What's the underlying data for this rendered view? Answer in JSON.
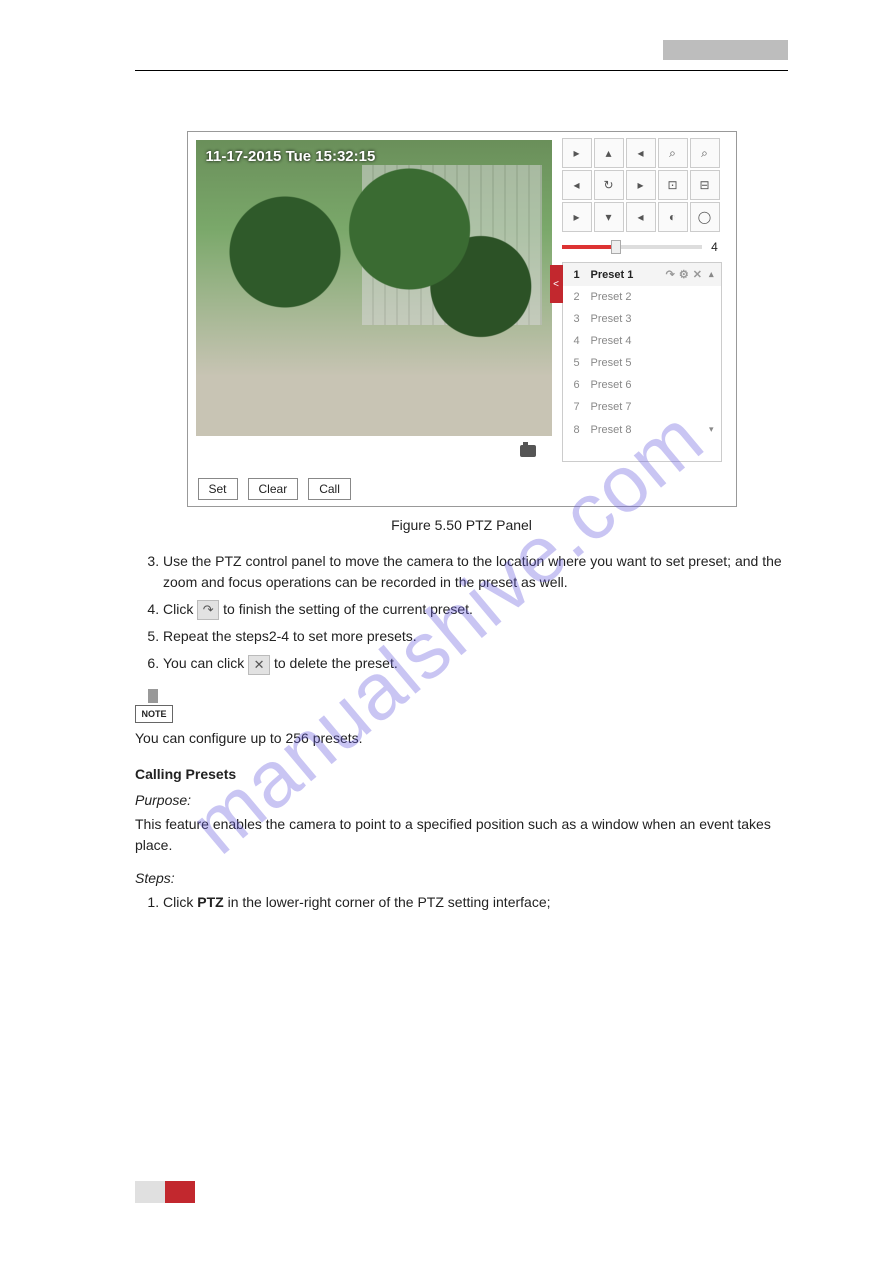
{
  "watermark": "manualshive.com",
  "figure": {
    "osd_text": "11-17-2015 Tue 15:32:15",
    "slider_value": "4",
    "presets": [
      {
        "num": "1",
        "label": "Preset 1"
      },
      {
        "num": "2",
        "label": "Preset 2"
      },
      {
        "num": "3",
        "label": "Preset 3"
      },
      {
        "num": "4",
        "label": "Preset 4"
      },
      {
        "num": "5",
        "label": "Preset 5"
      },
      {
        "num": "6",
        "label": "Preset 6"
      },
      {
        "num": "7",
        "label": "Preset 7"
      },
      {
        "num": "8",
        "label": "Preset 8"
      }
    ],
    "buttons": {
      "set": "Set",
      "clear": "Clear",
      "call": "Call"
    },
    "preset_action_call": "↷",
    "preset_action_gear": "⚙",
    "preset_action_del": "✕",
    "collapse_glyph": "<",
    "caption": "Figure 5.50 PTZ Panel"
  },
  "ptz_glyphs": {
    "ul": "▸",
    "u": "▴",
    "ur": "◂",
    "zp": "⌕",
    "zm": "⌕",
    "l": "◂",
    "c": "↻",
    "r": "▸",
    "fp": "⊡",
    "fm": "⊟",
    "dl": "▸",
    "d": "▾",
    "dr": "◂",
    "ip": "◐",
    "im": "◯"
  },
  "steps_1": {
    "s3": "Use the PTZ control panel to move the camera to the location where you want to set preset; and the zoom and focus operations can be recorded in the preset as well.",
    "s4a": "Click ",
    "s4b": " to finish the setting of the current preset.",
    "s5": "Repeat the steps2-4 to set more presets.",
    "s6a": "You can click ",
    "s6b": " to delete the preset."
  },
  "note": {
    "label": "NOTE",
    "text": "You can configure up to 256 presets."
  },
  "calling": {
    "title": "Calling Presets",
    "purpose_label": "Purpose:",
    "purpose_text": "This feature enables the camera to point to a specified position such as a window when an event takes place.",
    "steps_label": "Steps:",
    "s1": "Click PTZ in the lower-right corner of the PTZ setting interface;"
  }
}
